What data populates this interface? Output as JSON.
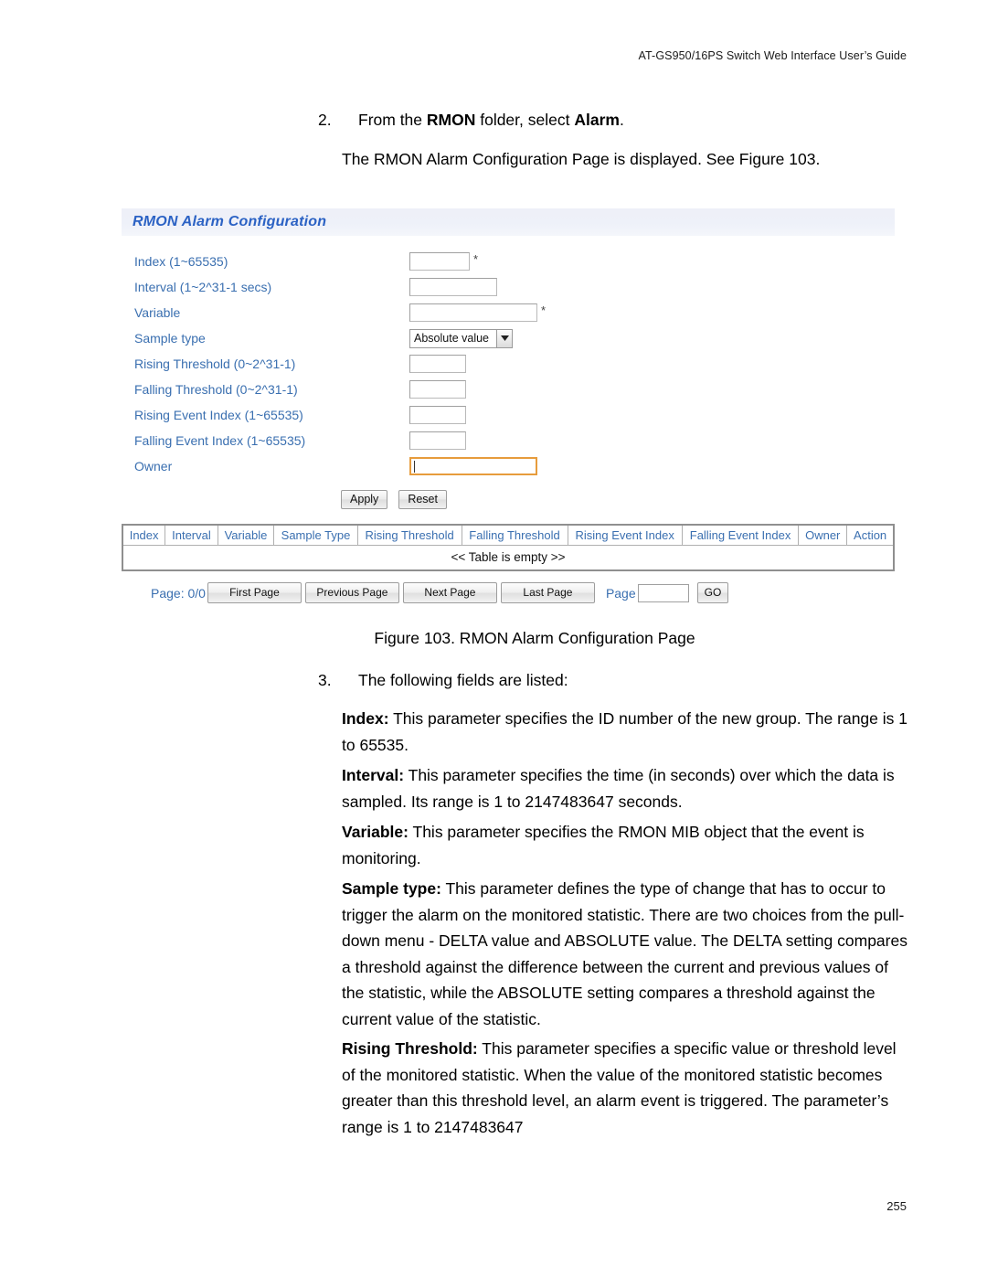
{
  "header": {
    "running_head": "AT-GS950/16PS Switch Web Interface User’s Guide"
  },
  "footer": {
    "page_number": "255"
  },
  "steps": {
    "step2": {
      "number": "2.",
      "text_before": "From the ",
      "bold1": "RMON",
      "text_middle": " folder, select ",
      "bold2": "Alarm",
      "text_after": "."
    },
    "step2_note": "The RMON Alarm Configuration Page is displayed. See Figure 103.",
    "step3": {
      "number": "3.",
      "text": "The following fields are listed:"
    }
  },
  "figure": {
    "caption": "Figure 103. RMON Alarm Configuration Page"
  },
  "panel": {
    "title": "RMON Alarm Configuration",
    "fields": [
      {
        "label": "Index (1~65535)",
        "value": "",
        "required": "*"
      },
      {
        "label": "Interval (1~2^31-1 secs)",
        "value": "",
        "required": ""
      },
      {
        "label": "Variable",
        "value": "",
        "required": "*"
      },
      {
        "label": "Sample type",
        "value": "Absolute value",
        "required": ""
      },
      {
        "label": "Rising Threshold (0~2^31-1)",
        "value": "",
        "required": ""
      },
      {
        "label": "Falling Threshold (0~2^31-1)",
        "value": "",
        "required": ""
      },
      {
        "label": "Rising Event Index (1~65535)",
        "value": "",
        "required": ""
      },
      {
        "label": "Falling Event Index (1~65535)",
        "value": "",
        "required": ""
      },
      {
        "label": "Owner",
        "value": "",
        "required": ""
      }
    ],
    "sample_type_selected": "Absolute value",
    "buttons": {
      "apply": "Apply",
      "reset": "Reset"
    },
    "table": {
      "columns": [
        "Index",
        "Interval",
        "Variable",
        "Sample Type",
        "Rising Threshold",
        "Falling Threshold",
        "Rising Event Index",
        "Falling Event Index",
        "Owner",
        "Action"
      ],
      "empty_message": "<< Table is empty >>",
      "rows": []
    },
    "pager": {
      "page_status": "Page: 0/0",
      "first_page": "First Page",
      "previous_page": "Previous Page",
      "next_page": "Next Page",
      "last_page": "Last Page",
      "page_label": "Page",
      "page_value": "",
      "go": "GO"
    }
  },
  "descriptions": [
    {
      "term": "Index:",
      "text": " This parameter specifies the ID number of the new group. The range is 1 to 65535."
    },
    {
      "term": "Interval:",
      "text": " This parameter specifies the time (in seconds) over which the data is sampled. Its range is 1 to 2147483647 seconds."
    },
    {
      "term": "Variable:",
      "text": " This parameter specifies the RMON MIB object that the event is monitoring."
    },
    {
      "term": "Sample type:",
      "text": " This parameter defines the type of change that has to occur to trigger the alarm on the monitored statistic. There are two choices from the pull-down menu - DELTA value and ABSOLUTE value. The DELTA setting compares a threshold against the difference between the current and previous values of the statistic, while the ABSOLUTE setting compares a threshold against the current value of the statistic."
    },
    {
      "term": "Rising Threshold:",
      "text": " This parameter specifies a specific value or threshold level of the monitored statistic. When the value of the monitored statistic becomes greater than this threshold level, an alarm event is triggered. The parameter’s range is 1 to 2147483647"
    }
  ],
  "colors": {
    "link_blue": "#3a6fb0",
    "title_blue": "#2b62c4",
    "focus_orange": "#e79c3c"
  }
}
